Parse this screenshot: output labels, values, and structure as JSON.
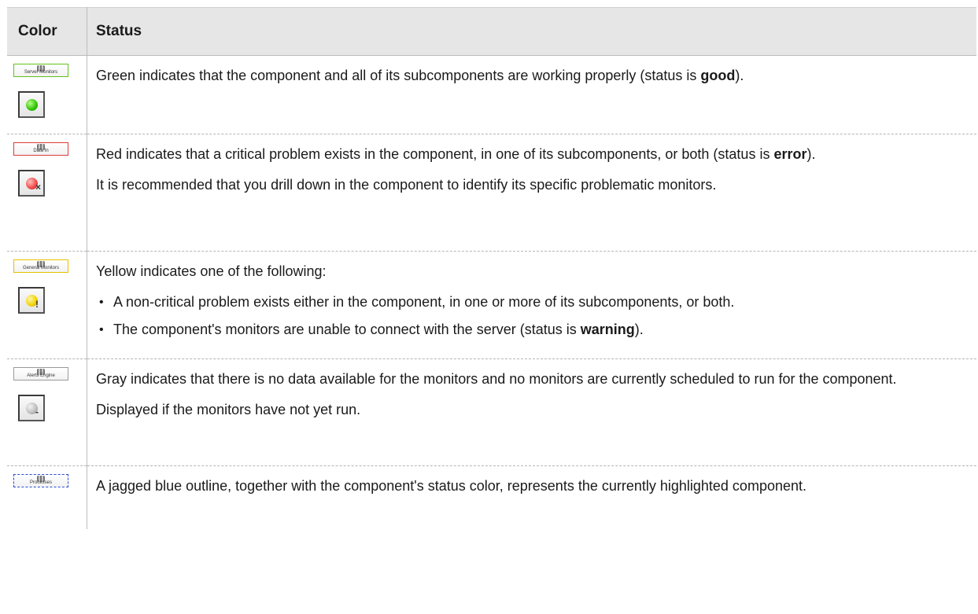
{
  "table": {
    "headers": {
      "color": "Color",
      "status": "Status"
    },
    "rows": [
      {
        "node_label": "Server Monitors",
        "node_color": "#63c21a",
        "status_icon": "green-status-icon",
        "p1_pre": "Green indicates that the component and all of its subcomponents are working properly (status is ",
        "p1_bold": "good",
        "p1_post": ")."
      },
      {
        "node_label": "Data In",
        "node_color": "#e23a3a",
        "status_icon": "red-error-status-icon",
        "mark": "×",
        "p1_pre": "Red indicates that a critical problem exists in the component, in one of its subcomponents, or both (status is ",
        "p1_bold": "error",
        "p1_post": ").",
        "p2": "It is recommended that you drill down in the component to identify its specific problematic monitors."
      },
      {
        "node_label": "General Monitors",
        "node_color": "#e6c000",
        "status_icon": "yellow-warning-status-icon",
        "mark": "!",
        "p1": "Yellow indicates one of the following:",
        "bullet1": "A non-critical problem exists either in the component, in one or more of its subcomponents, or both.",
        "bullet2_pre": "The component's monitors are unable to connect with the server (status is ",
        "bullet2_bold": "warning",
        "bullet2_post": ")."
      },
      {
        "node_label": "Alerts Engine",
        "node_color": "#9a9a9a",
        "status_icon": "gray-no-data-status-icon",
        "mark": "-",
        "p1": "Gray indicates that there is no data available for the monitors and no monitors are currently scheduled to run for the component.",
        "p2": "Displayed if the monitors have not yet run."
      },
      {
        "node_label": "Processes",
        "node_color": "#2b4fd8",
        "p1": "A jagged blue outline, together with the component's status color, represents the currently highlighted component."
      }
    ]
  }
}
